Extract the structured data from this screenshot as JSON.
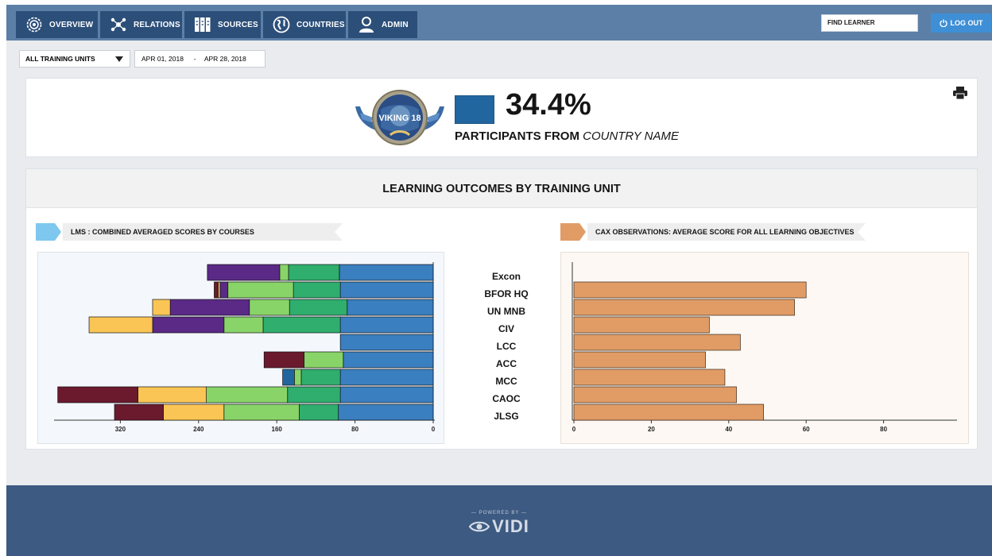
{
  "nav": {
    "tabs": [
      {
        "label": "OVERVIEW",
        "icon": "overview-icon"
      },
      {
        "label": "RELATIONS",
        "icon": "relations-icon"
      },
      {
        "label": "SOURCES",
        "icon": "sources-icon"
      },
      {
        "label": "COUNTRIES",
        "icon": "globe-icon"
      },
      {
        "label": "ADMIN",
        "icon": "user-icon"
      }
    ],
    "find_learner": "FIND LEARNER",
    "logout": "LOG OUT"
  },
  "filters": {
    "training_unit": "ALL TRAINING UNITS",
    "date_from": "APR 01, 2018",
    "date_sep": "-",
    "date_to": "APR 28, 2018"
  },
  "kpi": {
    "logo_text": "VIKING 18",
    "value": "34.4%",
    "label_prefix": "PARTICIPANTS FROM",
    "label_country": "COUNTRY NAME",
    "swatch_color": "#2266a0"
  },
  "section": {
    "title": "LEARNING OUTCOMES BY TRAINING UNIT",
    "lms_title": "LMS : COMBINED AVERAGED SCORES BY COURSES",
    "cax_title": "CAX OBSERVATIONS: AVERAGE SCORE FOR ALL LEARNING OBJECTIVES"
  },
  "categories": [
    "Excon",
    "BFOR HQ",
    "UN MNB",
    "CIV",
    "LCC",
    "ACC",
    "MCC",
    "CAOC",
    "JLSG"
  ],
  "chart_data": [
    {
      "type": "bar",
      "orientation": "horizontal",
      "stacked": true,
      "reversed_x": true,
      "title": "LMS : COMBINED AVERAGED SCORES BY COURSES",
      "categories": [
        "Excon",
        "BFOR HQ",
        "UN MNB",
        "CIV",
        "LCC",
        "ACC",
        "MCC",
        "CAOC",
        "JLSG"
      ],
      "xlim": [
        0,
        380
      ],
      "xticks": [
        320,
        240,
        160,
        80,
        0
      ],
      "grid": false,
      "series_colors": [
        "#3a7fbf",
        "#2fae6e",
        "#88d468",
        "#5a2a86",
        "#fbc555",
        "#6b1a2e",
        "#2266a0"
      ],
      "series": [
        {
          "values": [
            96,
            95,
            88,
            95,
            95,
            92,
            95,
            95,
            97
          ]
        },
        {
          "values": [
            52,
            48,
            59,
            79,
            0,
            0,
            40,
            54,
            40
          ]
        },
        {
          "values": [
            9,
            67,
            41,
            40,
            0,
            40,
            7,
            83,
            77
          ]
        },
        {
          "values": [
            74,
            8,
            81,
            73,
            0,
            0,
            0,
            0,
            0
          ]
        },
        {
          "values": [
            0,
            2,
            18,
            65,
            0,
            0,
            0,
            70,
            62
          ]
        },
        {
          "values": [
            0,
            4,
            0,
            0,
            0,
            41,
            0,
            82,
            50
          ]
        },
        {
          "values": [
            0,
            0,
            0,
            0,
            0,
            0,
            12,
            0,
            0
          ]
        }
      ]
    },
    {
      "type": "bar",
      "orientation": "horizontal",
      "title": "CAX OBSERVATIONS: AVERAGE SCORE FOR ALL LEARNING OBJECTIVES",
      "categories": [
        "Excon",
        "BFOR HQ",
        "UN MNB",
        "CIV",
        "LCC",
        "ACC",
        "MCC",
        "CAOC",
        "JLSG"
      ],
      "values": [
        0,
        60,
        57,
        35,
        43,
        34,
        39,
        42,
        49
      ],
      "xlim": [
        0,
        100
      ],
      "xticks": [
        0,
        20,
        40,
        60,
        80
      ],
      "grid": false,
      "bar_color": "#e19c66"
    }
  ]
}
